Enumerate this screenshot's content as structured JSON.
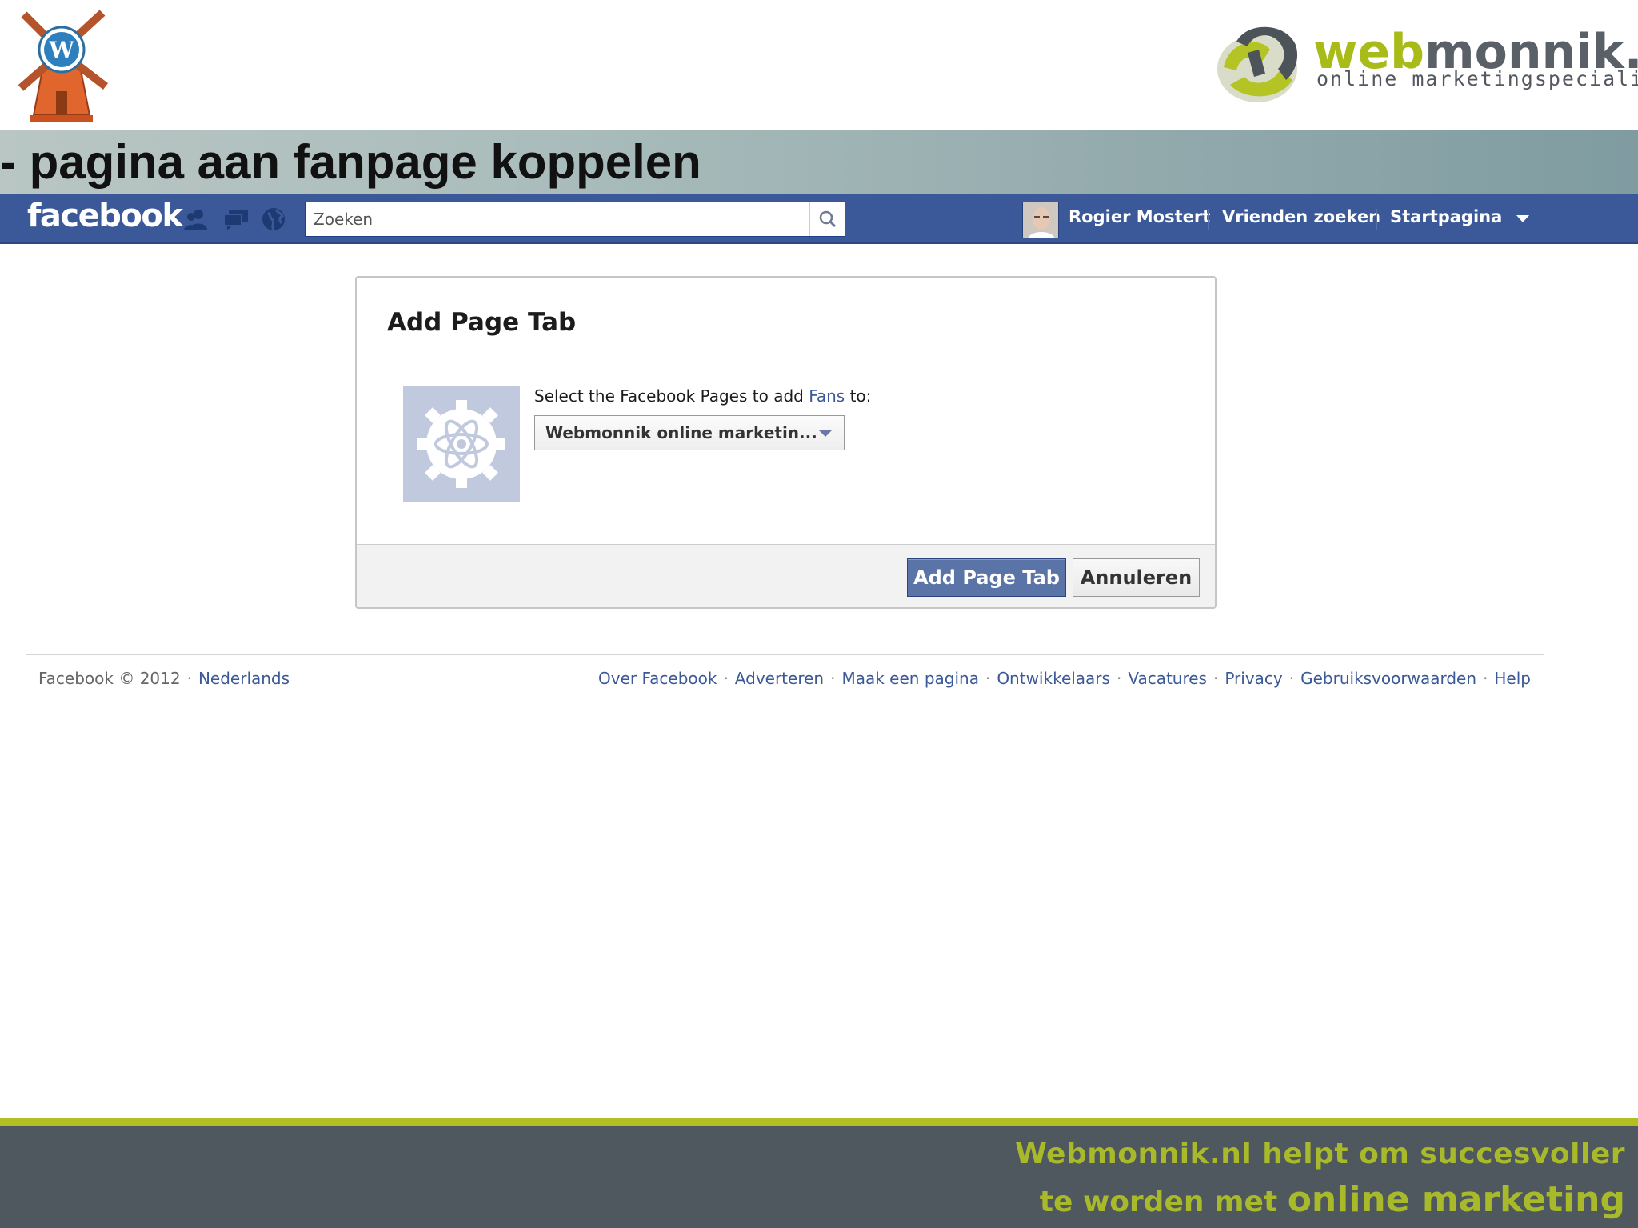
{
  "slide": {
    "title": "- pagina aan fanpage koppelen",
    "brand_name_accent": "web",
    "brand_name_rest": "monnik.nl",
    "brand_tagline": "online marketingspecialist",
    "footer_line1": "Webmonnik.nl helpt om succesvoller",
    "footer_line2_prefix": "te worden met ",
    "footer_line2_emph": "online marketing"
  },
  "facebook": {
    "logo": "facebook",
    "jewels": [
      "friend-requests-icon",
      "messages-icon",
      "notifications-icon"
    ],
    "search": {
      "placeholder": "Zoeken",
      "value": ""
    },
    "nav": {
      "user": "Rogier Mostert",
      "find_friends": "Vrienden zoeken",
      "home": "Startpagina"
    }
  },
  "dialog": {
    "title": "Add Page Tab",
    "select_label_prefix": "Select the Facebook Pages to add ",
    "select_label_link": "Fans",
    "select_label_suffix": " to:",
    "selected_page": "Webmonnik online marketin...",
    "primary_button": "Add Page Tab",
    "cancel_button": "Annuleren"
  },
  "footer": {
    "copyright": "Facebook © 2012",
    "language": "Nederlands",
    "links": [
      "Over Facebook",
      "Adverteren",
      "Maak een pagina",
      "Ontwikkelaars",
      "Vacatures",
      "Privacy",
      "Gebruiksvoorwaarden",
      "Help"
    ]
  },
  "colors": {
    "facebook_blue": "#3b5998",
    "brand_green": "#a9bb18",
    "band_gray": "#4f575f"
  }
}
